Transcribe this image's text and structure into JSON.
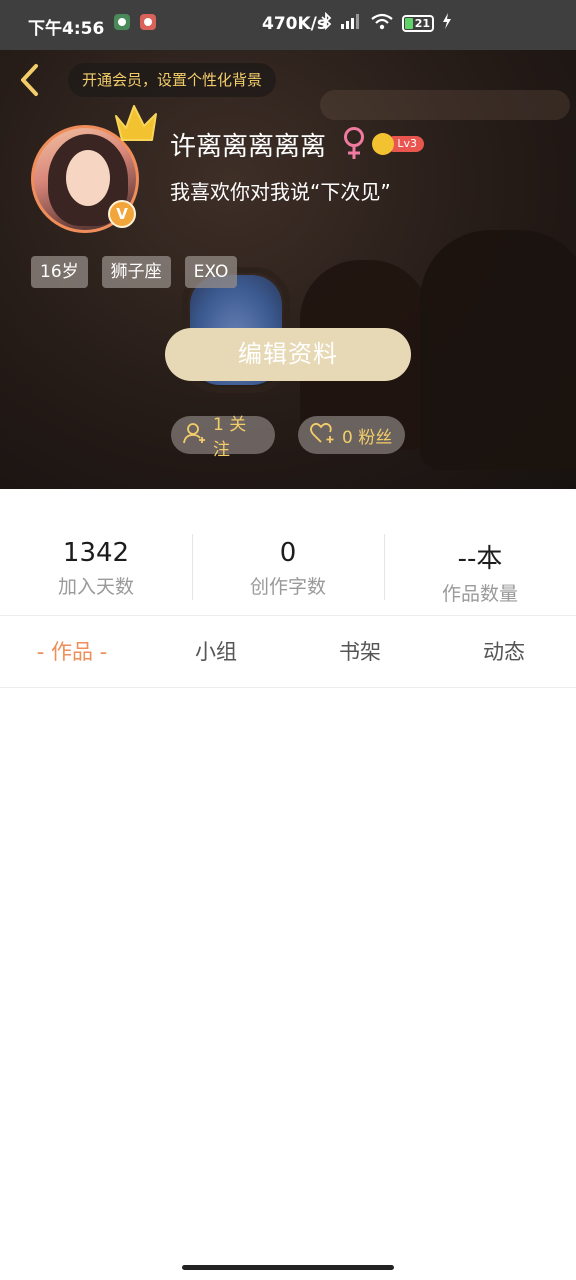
{
  "status_bar": {
    "time": "下午4:56",
    "net_speed": "470K/s",
    "battery": "21"
  },
  "header": {
    "vip_banner": "开通会员，设置个性化背景"
  },
  "profile": {
    "nickname": "许离离离离离",
    "gender_symbol": "♀",
    "level": "Lv3",
    "verified_badge": "V",
    "signature": "我喜欢你对我说“下次见”",
    "tags": [
      "16岁",
      "狮子座",
      "EXO"
    ],
    "edit_button": "编辑资料",
    "follow_label": "1 关注",
    "fans_label": "0 粉丝"
  },
  "stats": [
    {
      "value": "1342",
      "label": "加入天数"
    },
    {
      "value": "0",
      "label": "创作字数"
    },
    {
      "value": "--本",
      "label": "作品数量"
    }
  ],
  "tabs": [
    {
      "label": "- 作品 -",
      "active": true
    },
    {
      "label": "小组",
      "active": false
    },
    {
      "label": "书架",
      "active": false
    },
    {
      "label": "动态",
      "active": false
    }
  ],
  "colors": {
    "accent": "#ef8e58",
    "gold": "#f3cd6a",
    "edit_button": "#e8d9b6"
  }
}
